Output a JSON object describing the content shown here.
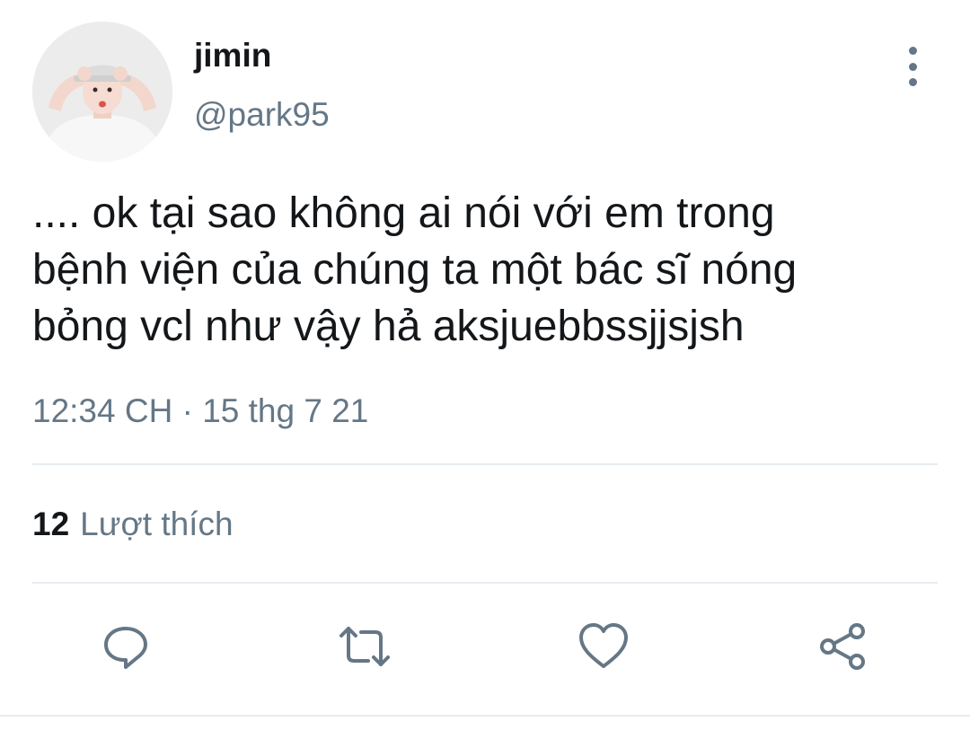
{
  "tweet": {
    "display_name": "jimin",
    "handle": "@park95",
    "text": ".... ok tại sao không ai nói với em trong\nbệnh viện của chúng ta một bác sĩ nóng\nbỏng vcl như vậy hả aksjuebbssjjsjsh",
    "timestamp": "12:34 CH · 15 thg 7 21",
    "likes_count": "12",
    "likes_label": "Lượt thích"
  },
  "actions": {
    "reply_icon": "reply-icon",
    "retweet_icon": "retweet-icon",
    "like_icon": "heart-icon",
    "share_icon": "share-icon"
  },
  "colors": {
    "text_primary": "#14171a",
    "text_secondary": "#657786",
    "divider": "#e6ecf0"
  }
}
